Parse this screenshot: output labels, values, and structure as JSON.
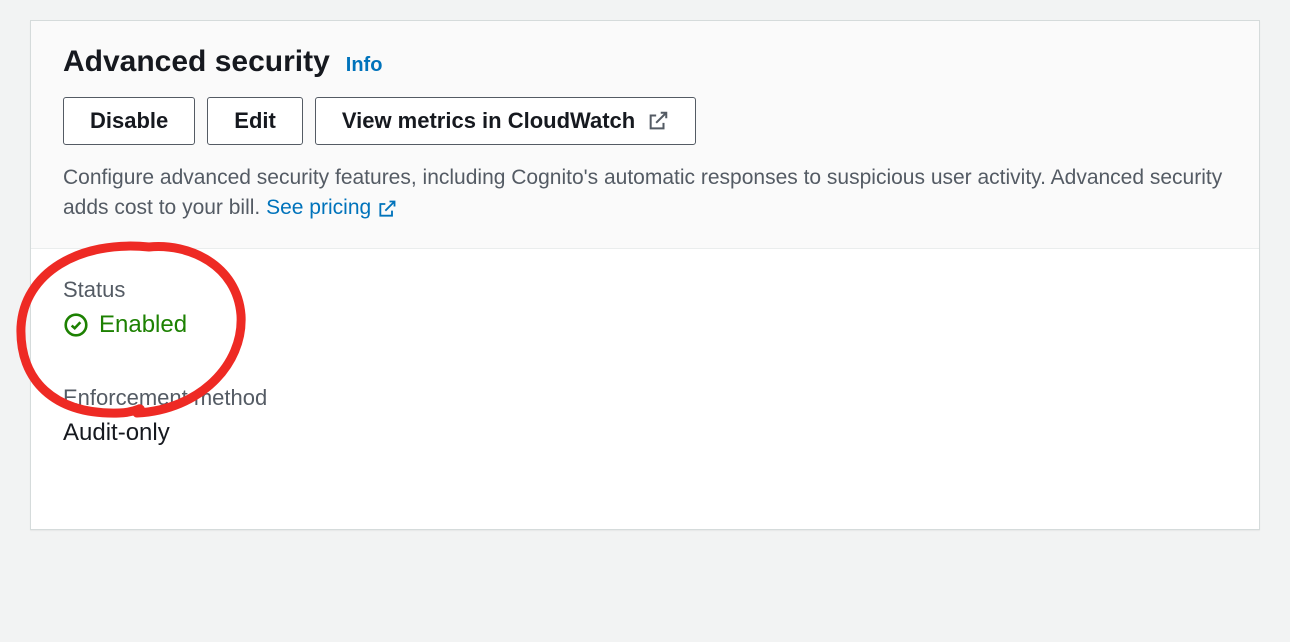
{
  "header": {
    "title": "Advanced security",
    "info_label": "Info",
    "buttons": {
      "disable": "Disable",
      "edit": "Edit",
      "view_metrics": "View metrics in CloudWatch"
    },
    "description_prefix": "Configure advanced security features, including Cognito's automatic responses to suspicious user activity. Advanced security adds cost to your bill. ",
    "pricing_link": "See pricing"
  },
  "body": {
    "status_label": "Status",
    "status_value": "Enabled",
    "enforcement_label": "Enforcement method",
    "enforcement_value": "Audit-only"
  }
}
